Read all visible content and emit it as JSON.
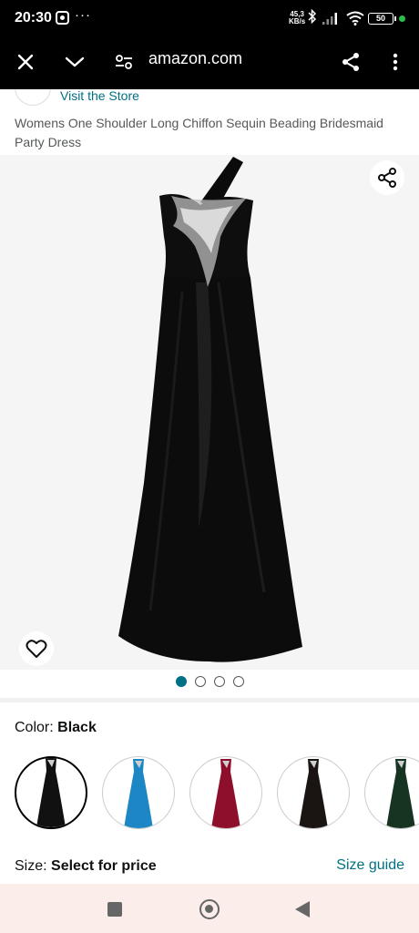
{
  "status_bar": {
    "time": "20:30",
    "more": "···",
    "speed_value": "45,3",
    "speed_unit": "KB/s",
    "battery": "50",
    "icons": [
      "app-notification-icon",
      "bluetooth-icon",
      "signal-icon",
      "wifi-icon",
      "battery-icon"
    ]
  },
  "toolbar": {
    "url": "amazon.com",
    "icons": [
      "close-icon",
      "chevron-down-icon",
      "site-settings-icon",
      "share-icon",
      "more-vert-icon"
    ]
  },
  "store": {
    "link": "Visit the Store"
  },
  "product": {
    "title": "Womens One Shoulder Long Chiffon Sequin Beading Bridesmaid Party Dress"
  },
  "gallery": {
    "image_count": 4,
    "active_index": 0
  },
  "color": {
    "label": "Color:",
    "value": "Black",
    "swatches": [
      {
        "color": "#111111",
        "selected": true
      },
      {
        "color": "#1d86c4",
        "selected": false
      },
      {
        "color": "#8e0f2c",
        "selected": false
      },
      {
        "color": "#1a1512",
        "selected": false
      },
      {
        "color": "#173322",
        "selected": false
      }
    ]
  },
  "size": {
    "label": "Size:",
    "value": "Select for price",
    "guide": "Size guide"
  },
  "colors": {
    "link": "#007185",
    "nav_bg": "#fbeeea"
  }
}
